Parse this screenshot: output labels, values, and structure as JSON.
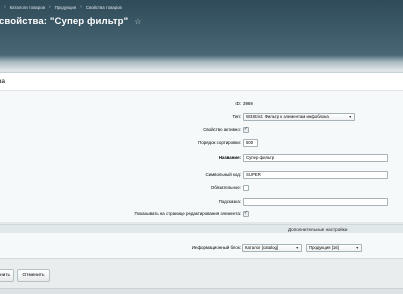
{
  "breadcrumb": [
    "Каталоги товаров",
    "Продукция",
    "Свойства товаров"
  ],
  "title": "свойства: \"Супер фильтр\"",
  "panel_header": "ва",
  "form": {
    "id_label": "ID:",
    "id_value": "3969",
    "type_label": "Тип:",
    "type_value": "W3Strict: Фильтр к элементам инфоблока",
    "active_label": "Свойство активно:",
    "active_checked": true,
    "sort_label": "Порядок сортировки:",
    "sort_value": "500",
    "name_label": "Название:",
    "name_value": "Супер фильтр",
    "code_label": "Символьный код:",
    "code_value": "SUPER",
    "required_label": "Обязательное:",
    "required_checked": false,
    "hint_label": "Подсказка:",
    "hint_value": "",
    "show_label": "Показывать на странице редактирования элемента:",
    "show_checked": true
  },
  "additional": {
    "title": "Дополнительные настройки",
    "iblock_label": "Информационный блок:",
    "catalog_value": "Каталог [catalog]",
    "product_value": "Продукция [16]"
  },
  "buttons": {
    "apply_label": "нить",
    "cancel_label": "Отменить"
  }
}
